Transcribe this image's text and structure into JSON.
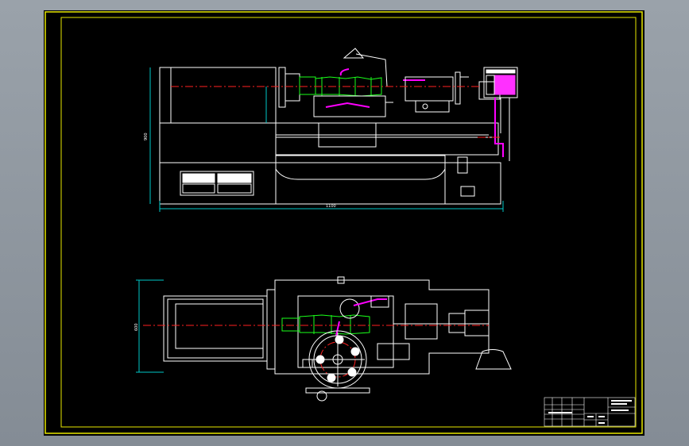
{
  "colors": {
    "sheet_background": "#000000",
    "frame": "#e8e800",
    "outline": "#ffffff",
    "centerline": "#ff2020",
    "spindle": "#1aff1a",
    "handles": "#ff00ff",
    "dimensions": "#00c8c8"
  },
  "front_view": {
    "dimension_overall": "1100",
    "dimension_height": "900"
  },
  "top_view": {
    "dimension_width": "600"
  }
}
